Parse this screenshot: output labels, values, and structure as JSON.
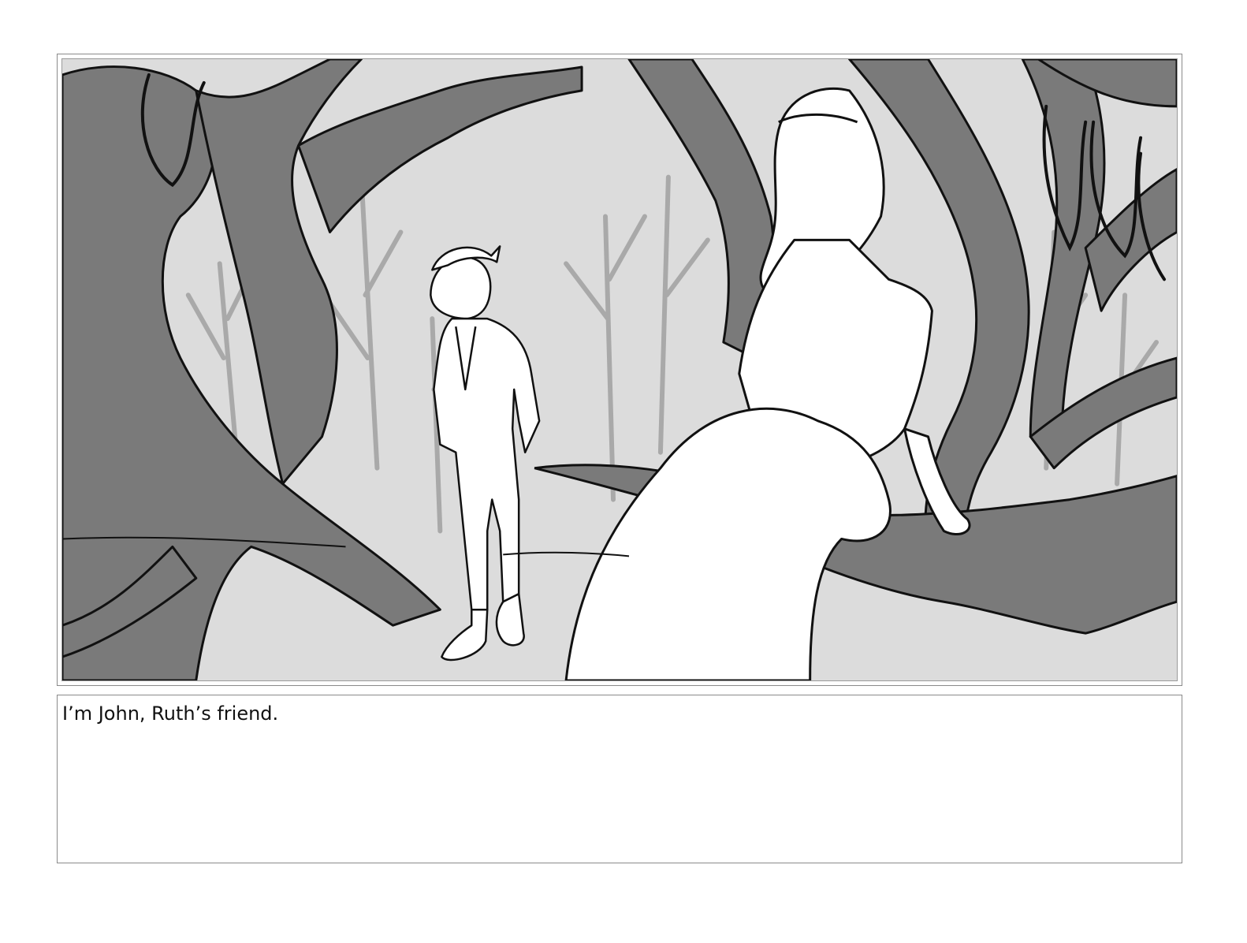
{
  "colors": {
    "background_fill": "#dcdcdc",
    "tree_fill": "#7a7a7a",
    "distant_branch": "#a9a9a9",
    "ink_line": "#111111",
    "figure_fill": "#ffffff",
    "frame_border": "#8a8a8a"
  },
  "storyboard": {
    "panel": {
      "scene_label": "forest-clearing-sketch",
      "characters": [
        "man-standing",
        "woman-sitting-on-branch"
      ]
    },
    "caption": {
      "text": "I’m John, Ruth’s friend."
    }
  }
}
